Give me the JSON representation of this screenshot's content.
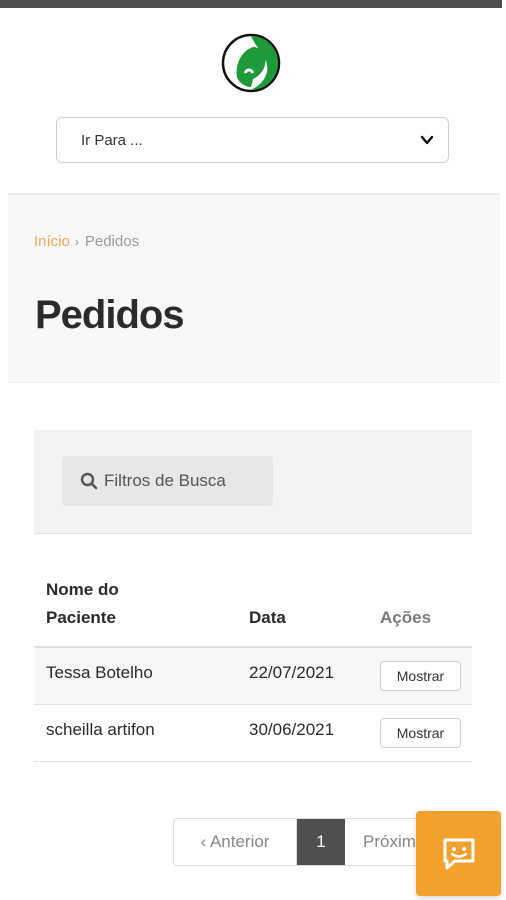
{
  "nav": {
    "goto_label": "Ir Para ..."
  },
  "breadcrumb": {
    "home": "Início",
    "separator": "›",
    "current": "Pedidos"
  },
  "page": {
    "title": "Pedidos"
  },
  "filters": {
    "label": "Filtros de Busca"
  },
  "table": {
    "headers": {
      "patient_line1": "Nome do",
      "patient_line2": "Paciente",
      "date": "Data",
      "actions": "Ações"
    },
    "rows": [
      {
        "patient": "Tessa Botelho",
        "date": "22/07/2021",
        "action": "Mostrar"
      },
      {
        "patient": "scheilla artifon",
        "date": "30/06/2021",
        "action": "Mostrar"
      }
    ]
  },
  "pagination": {
    "prev": "‹ Anterior",
    "page": "1",
    "next": "Próxima ›"
  },
  "colors": {
    "accent": "#f3a12d",
    "link": "#f0a656",
    "logo_green": "#1f9a3a",
    "dark": "#4f4f4f"
  },
  "icons": {
    "logo": "woman-silhouette-logo",
    "dropdown": "chevron-down-icon",
    "search": "search-icon",
    "chat": "chat-icon"
  }
}
